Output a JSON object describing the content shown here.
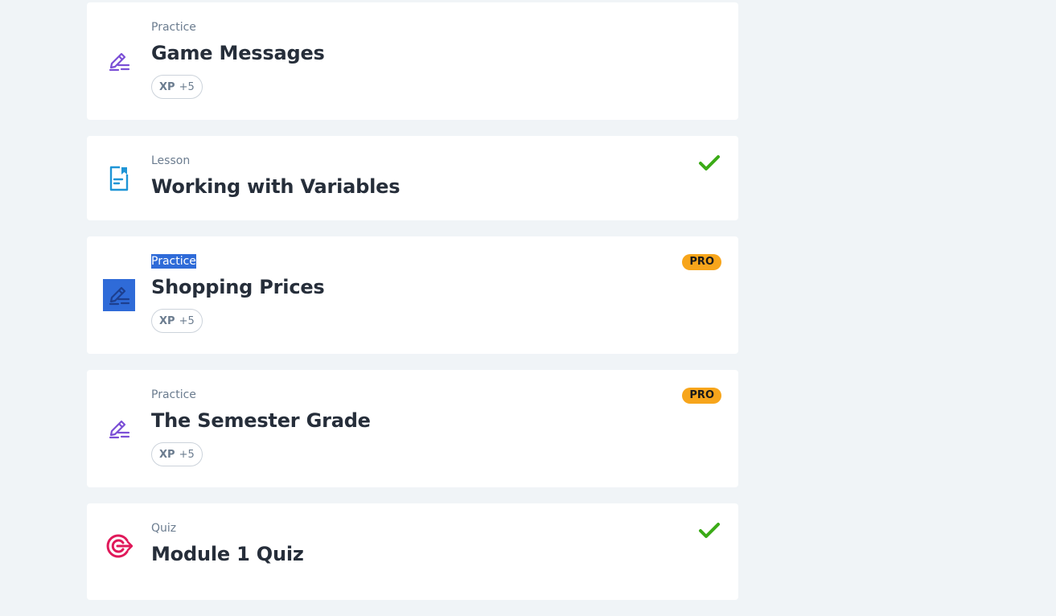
{
  "items": [
    {
      "type": "Practice",
      "title": "Game Messages",
      "xp_label": "XP",
      "xp_value": "+5",
      "icon": "pencil-icon",
      "completed": false,
      "pro": false
    },
    {
      "type": "Lesson",
      "title": "Working with Variables",
      "icon": "lesson-document-icon",
      "completed": true,
      "pro": false
    },
    {
      "type": "Practice",
      "title": "Shopping Prices",
      "xp_label": "XP",
      "xp_value": "+5",
      "icon": "pencil-icon",
      "completed": false,
      "pro": true,
      "pro_label": "PRO",
      "selected": true
    },
    {
      "type": "Practice",
      "title": "The Semester Grade",
      "xp_label": "XP",
      "xp_value": "+5",
      "icon": "pencil-icon",
      "completed": false,
      "pro": true,
      "pro_label": "PRO"
    },
    {
      "type": "Quiz",
      "title": "Module 1 Quiz",
      "icon": "target-icon",
      "completed": true,
      "pro": false
    }
  ],
  "colors": {
    "practice_icon": "#7b4fd6",
    "lesson_icon": "#1f95d6",
    "quiz_icon": "#e0195a",
    "check": "#3bab17",
    "pro_badge": "#f7a51b",
    "selection": "#2f6bd8"
  }
}
